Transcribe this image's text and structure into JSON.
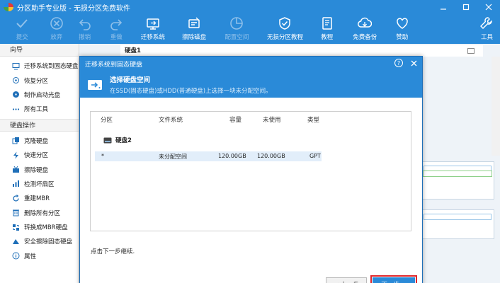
{
  "window": {
    "title": "分区助手专业版 - 无损分区免费软件",
    "controls": [
      "minimize",
      "maximize",
      "close"
    ]
  },
  "toolbar": {
    "buttons": [
      {
        "label": "提交",
        "icon": "check-icon",
        "enabled": false
      },
      {
        "label": "放弃",
        "icon": "cancel-icon",
        "enabled": false
      },
      {
        "label": "撤销",
        "icon": "undo-icon",
        "enabled": false
      },
      {
        "label": "重做",
        "icon": "redo-icon",
        "enabled": false
      },
      {
        "label": "迁移系统",
        "icon": "migrate-icon",
        "enabled": true
      },
      {
        "label": "擦除磁盘",
        "icon": "wipe-disk-icon",
        "enabled": true
      },
      {
        "label": "配置空间",
        "icon": "allocate-space-icon",
        "enabled": false
      },
      {
        "label": "无损分区教程",
        "icon": "shield-check-icon",
        "enabled": true
      },
      {
        "label": "教程",
        "icon": "book-icon",
        "enabled": true
      },
      {
        "label": "免费备份",
        "icon": "backup-icon",
        "enabled": true
      },
      {
        "label": "赞助",
        "icon": "heart-icon",
        "enabled": true
      },
      {
        "label": "工具",
        "icon": "wrench-icon",
        "enabled": true
      }
    ]
  },
  "sidebar": {
    "wizard_header": "向导",
    "wizard_items": [
      {
        "label": "迁移系统到固态硬盘",
        "icon": "migrate-icon"
      },
      {
        "label": "恢复分区",
        "icon": "restore-icon"
      },
      {
        "label": "制作启动光盘",
        "icon": "boot-disc-icon"
      },
      {
        "label": "所有工具",
        "icon": "more-icon"
      }
    ],
    "disk_header": "硬盘操作",
    "disk_items": [
      {
        "label": "克隆硬盘",
        "icon": "clone-disk-icon"
      },
      {
        "label": "快速分区",
        "icon": "quick-partition-icon"
      },
      {
        "label": "擦除硬盘",
        "icon": "wipe-disk-icon"
      },
      {
        "label": "检测坏扇区",
        "icon": "bad-sector-icon"
      },
      {
        "label": "重建MBR",
        "icon": "rebuild-mbr-icon"
      },
      {
        "label": "删除所有分区",
        "icon": "delete-partitions-icon"
      },
      {
        "label": "转换成MBR硬盘",
        "icon": "convert-mbr-icon"
      },
      {
        "label": "安全擦除固态硬盘",
        "icon": "secure-erase-icon"
      },
      {
        "label": "属性",
        "icon": "info-icon"
      }
    ]
  },
  "main": {
    "disk_header": "硬盘1"
  },
  "dialog": {
    "title": "迁移系统到固态硬盘",
    "step_title": "选择硬盘空间",
    "step_subtitle": "在SSD(固态硬盘)或HDD(普通硬盘)上选择一块未分配空间。",
    "columns": [
      "分区",
      "文件系统",
      "容量",
      "未使用",
      "类型"
    ],
    "disk_label": "硬盘2",
    "rows": [
      {
        "partition": "*",
        "filesystem": "未分配空间",
        "capacity": "120.00GB",
        "unused": "120.00GB",
        "type": "GPT"
      }
    ],
    "hint": "点击下一步继续.",
    "prev_button": "< 上一步",
    "next_button": "下一步 >"
  },
  "colors": {
    "accent": "#2a8ad8",
    "highlight_row": "#e2eefa",
    "next_outline": "#e0262a"
  }
}
